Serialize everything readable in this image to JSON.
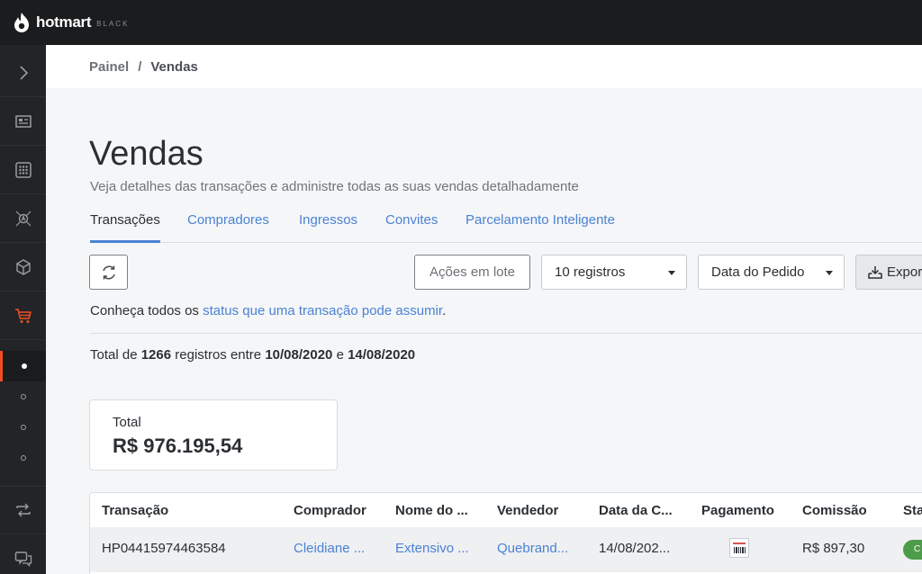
{
  "brand": {
    "name": "hotmart",
    "tier": "BLACK"
  },
  "breadcrumb": {
    "parent": "Painel",
    "separator": "/",
    "current": "Vendas"
  },
  "page": {
    "title": "Vendas",
    "subtitle": "Veja detalhes das transações e administre todas as suas vendas detalhadamente"
  },
  "tabs": [
    {
      "label": "Transações",
      "active": true
    },
    {
      "label": "Compradores"
    },
    {
      "label": "Ingressos"
    },
    {
      "label": "Convites"
    },
    {
      "label": "Parcelamento Inteligente"
    }
  ],
  "toolbar": {
    "batch_actions": "Ações em lote",
    "page_size": "10 registros",
    "date_filter": "Data do Pedido",
    "export": "Expor"
  },
  "info": {
    "prefix": "Conheça todos os",
    "link": "status que uma transação pode assumir",
    "suffix": "."
  },
  "summary": {
    "prefix": "Total de",
    "count": "1266",
    "middle": "registros entre",
    "start_date": "10/08/2020",
    "joiner": "e",
    "end_date": "14/08/2020"
  },
  "total_card": {
    "label": "Total",
    "value": "R$ 976.195,54"
  },
  "table": {
    "headers": [
      "Transação",
      "Comprador",
      "Nome do ...",
      "Vendedor",
      "Data da C...",
      "Pagamento",
      "Comissão",
      "Sta"
    ],
    "rows": [
      {
        "transaction": "HP04415974463584",
        "buyer": "Cleidiane ...",
        "product": "Extensivo ...",
        "seller": "Quebrand...",
        "date": "14/08/202...",
        "payment_icon": "boleto-icon",
        "commission": "R$ 897,30",
        "status": "C"
      }
    ]
  },
  "colors": {
    "accent": "#4a82d4",
    "brand_orange": "#ef4e23",
    "topbar": "#1b1c1e",
    "sidebar": "#232427",
    "status_green": "#4e9b4a"
  }
}
